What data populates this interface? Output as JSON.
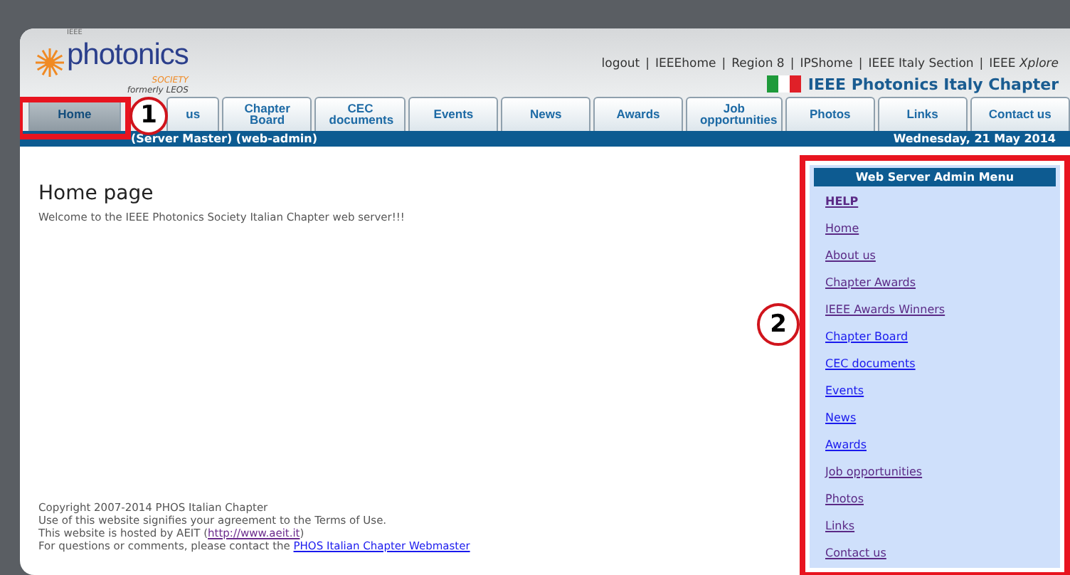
{
  "logo": {
    "prefix": "IEEE",
    "name": "photonics",
    "society": "SOCIETY",
    "formerly": "formerly LEOS"
  },
  "top_link_separator": "|",
  "top_links": [
    "logout",
    "IEEEhome",
    "Region 8",
    "IPShome",
    "IEEE Italy Section",
    "IEEE *Xplore*"
  ],
  "chapter_title": "IEEE Photonics Italy Chapter",
  "tabs": [
    {
      "label": "Home",
      "selected": true
    },
    {
      "label": "us",
      "selected": false
    },
    {
      "label": "Chapter Board",
      "selected": false
    },
    {
      "label": "CEC documents",
      "selected": false
    },
    {
      "label": "Events",
      "selected": false
    },
    {
      "label": "News",
      "selected": false
    },
    {
      "label": "Awards",
      "selected": false
    },
    {
      "label": "Job opportunities",
      "selected": false
    },
    {
      "label": "Photos",
      "selected": false
    },
    {
      "label": "Links",
      "selected": false
    },
    {
      "label": "Contact us",
      "selected": false
    }
  ],
  "status_bar": {
    "user": "(Server Master) (web-admin)",
    "date": "Wednesday, 21 May 2014"
  },
  "main": {
    "title": "Home page",
    "welcome": "Welcome to the IEEE Photonics Society Italian Chapter web server!!!"
  },
  "footer": {
    "lines": [
      "Copyright 2007-2014 PHOS Italian Chapter",
      "Use of this website signifies your agreement to the Terms of Use."
    ],
    "hosted_text": "This website is hosted by AEIT (",
    "hosted_link": "http://www.aeit.it",
    "hosted_end": ")",
    "contact_text": "For questions or comments, please contact the ",
    "contact_link": "PHOS Italian Chapter Webmaster"
  },
  "admin_menu": {
    "title": "Web Server Admin Menu",
    "items": [
      {
        "label": "HELP",
        "visited": true,
        "bold": true
      },
      {
        "label": "Home",
        "visited": true,
        "bold": false
      },
      {
        "label": "About us",
        "visited": true,
        "bold": false
      },
      {
        "label": "Chapter Awards",
        "visited": true,
        "bold": false
      },
      {
        "label": "IEEE Awards Winners",
        "visited": true,
        "bold": false
      },
      {
        "label": "Chapter Board",
        "visited": false,
        "bold": false
      },
      {
        "label": "CEC documents",
        "visited": false,
        "bold": false
      },
      {
        "label": "Events",
        "visited": false,
        "bold": false
      },
      {
        "label": "News",
        "visited": false,
        "bold": false
      },
      {
        "label": "Awards",
        "visited": false,
        "bold": false
      },
      {
        "label": "Job opportunities",
        "visited": true,
        "bold": false
      },
      {
        "label": "Photos",
        "visited": true,
        "bold": false
      },
      {
        "label": "Links",
        "visited": true,
        "bold": false
      },
      {
        "label": "Contact us",
        "visited": true,
        "bold": false
      }
    ]
  },
  "callouts": [
    "1",
    "2"
  ]
}
